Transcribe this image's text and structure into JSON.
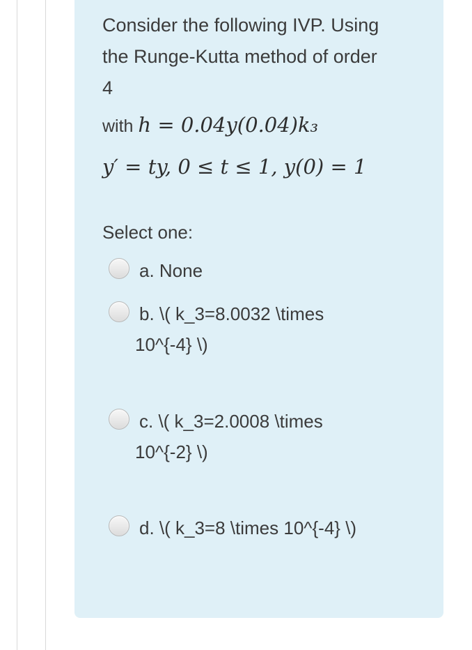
{
  "question": {
    "text_lines": [
      "Consider the following IVP. Using",
      "the Runge-Kutta method of order",
      "4"
    ],
    "with_prefix": "with",
    "with_math": "h = 0.04y(0.04)k₃",
    "ivp_math": "y′ = ty,  0 ≤ t ≤ 1,  y(0) = 1"
  },
  "select_label": "Select one:",
  "options": [
    {
      "line1": "a. None",
      "line2": ""
    },
    {
      "line1": "b. \\( k_3=8.0032 \\times",
      "line2": "10^{-4} \\)"
    },
    {
      "line1": "c. \\( k_3=2.0008 \\times",
      "line2": "10^{-2} \\)"
    },
    {
      "line1": "d. \\( k_3=8 \\times 10^{-4} \\)",
      "line2": ""
    }
  ],
  "colors": {
    "question_box": "#dff0f7",
    "text": "#3b3b3b"
  }
}
